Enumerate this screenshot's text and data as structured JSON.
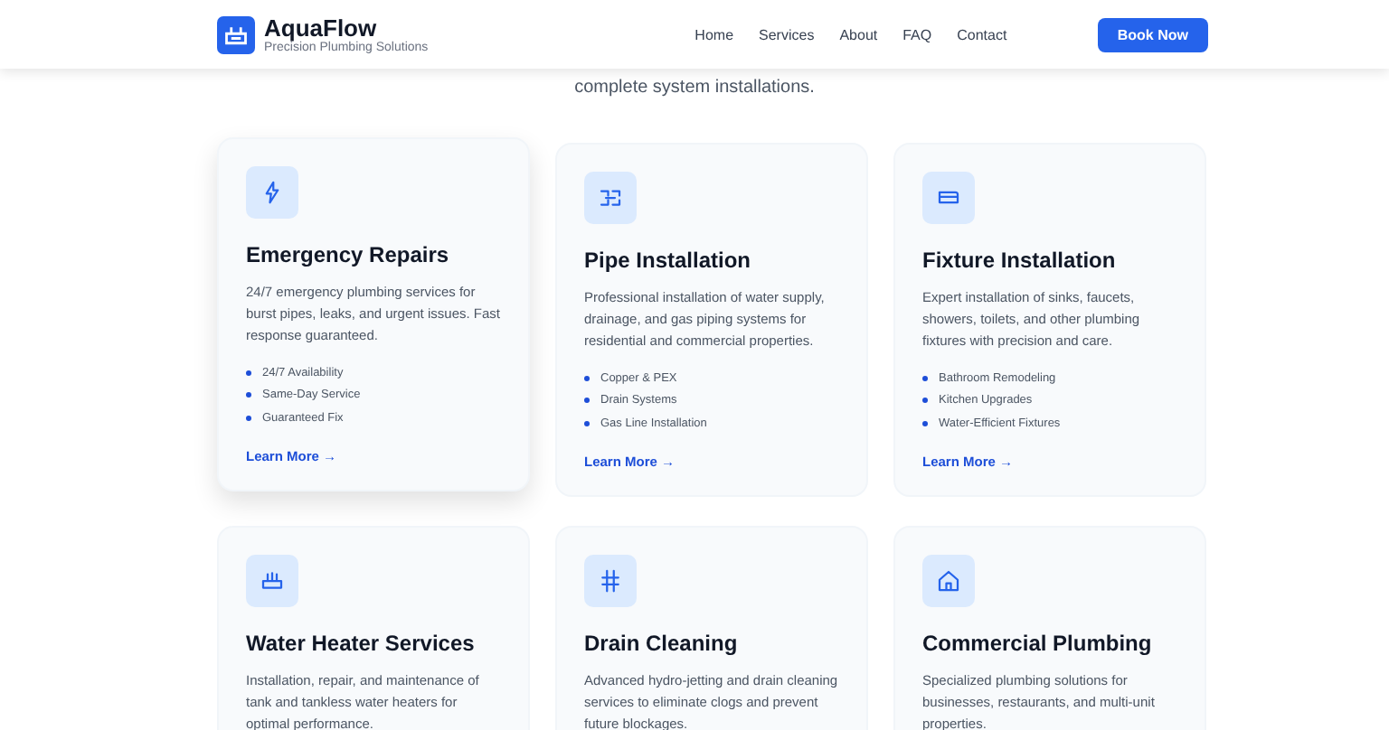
{
  "header": {
    "brand": "AquaFlow",
    "tagline": "Precision Plumbing Solutions",
    "nav": [
      "Home",
      "Services",
      "About",
      "FAQ",
      "Contact"
    ],
    "cta": "Book Now"
  },
  "intro": "complete system installations.",
  "services": [
    {
      "title": "Emergency Repairs",
      "highlighted": true,
      "description": "24/7 emergency plumbing services for burst pipes, leaks, and urgent issues. Fast response guaranteed.",
      "features": [
        "24/7 Availability",
        "Same-Day Service",
        "Guaranteed Fix"
      ],
      "link": "Learn More →"
    },
    {
      "title": "Pipe Installation",
      "highlighted": false,
      "description": "Professional installation of water supply, drainage, and gas piping systems for residential and commercial properties.",
      "features": [
        "Copper & PEX",
        "Drain Systems",
        "Gas Line Installation"
      ],
      "link": "Learn More →"
    },
    {
      "title": "Fixture Installation",
      "highlighted": false,
      "description": "Expert installation of sinks, faucets, showers, toilets, and other plumbing fixtures with precision and care.",
      "features": [
        "Bathroom Remodeling",
        "Kitchen Upgrades",
        "Water-Efficient Fixtures"
      ],
      "link": "Learn More →"
    },
    {
      "title": "Water Heater Services",
      "highlighted": false,
      "description": "Installation, repair, and maintenance of tank and tankless water heaters for optimal performance."
    },
    {
      "title": "Drain Cleaning",
      "highlighted": false,
      "description": "Advanced hydro-jetting and drain cleaning services to eliminate clogs and prevent future blockages."
    },
    {
      "title": "Commercial Plumbing",
      "highlighted": false,
      "description": "Specialized plumbing solutions for businesses, restaurants, and multi-unit properties."
    }
  ]
}
